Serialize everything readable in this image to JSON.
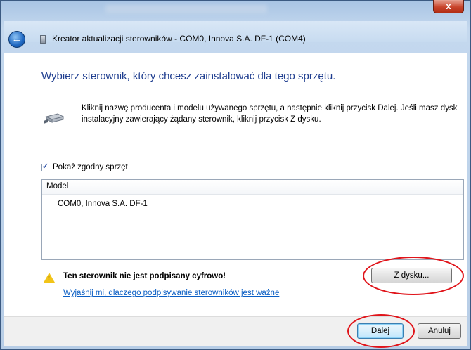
{
  "window": {
    "close_glyph": "x",
    "back_glyph": "←",
    "title": "Kreator aktualizacji sterowników - COM0, Innova S.A. DF-1 (COM4)"
  },
  "main": {
    "heading": "Wybierz sterownik, który chcesz zainstalować dla tego sprzętu.",
    "instructions": "Kliknij nazwę producenta i modelu używanego sprzętu, a następnie kliknij przycisk Dalej. Jeśli masz dysk instalacyjny zawierający żądany sterownik, kliknij przycisk Z dysku.",
    "checkbox_label": "Pokaż zgodny sprzęt",
    "checkbox_checked": true,
    "list": {
      "column_header": "Model",
      "items": [
        "COM0, Innova S.A. DF-1"
      ]
    },
    "warning": {
      "glyph": "!",
      "text": "Ten sterownik nie jest podpisany cyfrowo!"
    },
    "link_text": "Wyjaśnij mi, dlaczego podpisywanie sterowników jest ważne",
    "have_disk_button": "Z dysku..."
  },
  "footer": {
    "next_button": "Dalej",
    "cancel_button": "Anuluj"
  },
  "icons": {
    "back": "back-arrow-icon",
    "device": "serial-port-icon",
    "warning": "warning-icon",
    "close": "close-icon"
  },
  "colors": {
    "heading": "#1e3d8f",
    "link": "#0a5ec4",
    "annotation": "#e0141a",
    "close_button": "#c9452c"
  }
}
